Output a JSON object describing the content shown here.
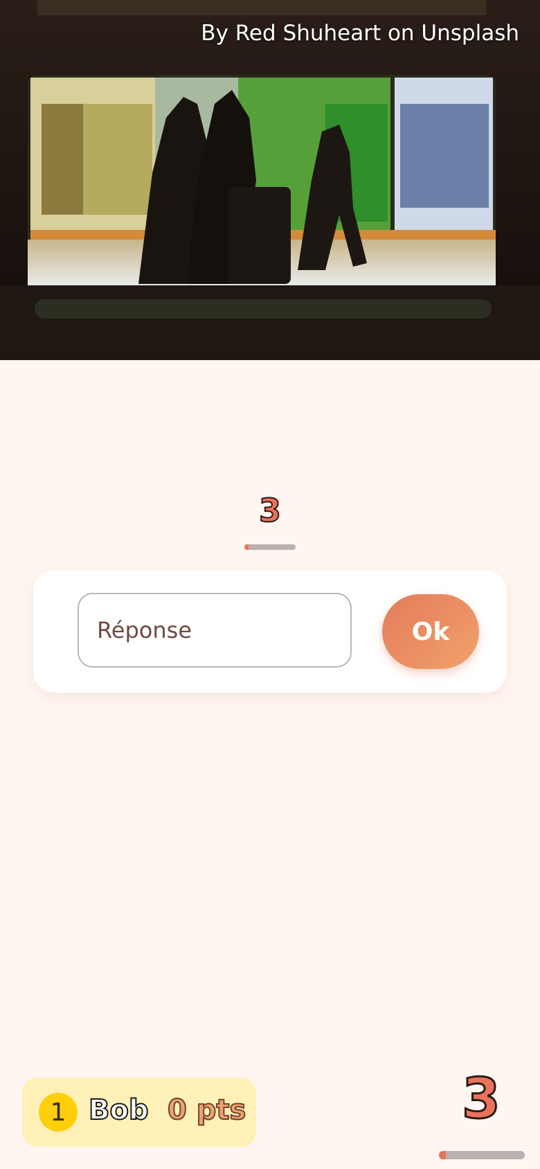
{
  "photo": {
    "credit": "By Red Shuheart on Unsplash"
  },
  "question": {
    "round_number": "3",
    "progress_fraction": 0.08
  },
  "answer": {
    "placeholder": "Réponse",
    "value": "",
    "submit_label": "Ok"
  },
  "player": {
    "rank": "1",
    "name": "Bob",
    "points": "0 pts"
  },
  "timer": {
    "value": "3",
    "progress_fraction": 0.08
  },
  "colors": {
    "accent": "#e8735a",
    "background": "#fff6f1",
    "player_card": "#fff0b8",
    "rank_badge": "#ffcf0a"
  }
}
